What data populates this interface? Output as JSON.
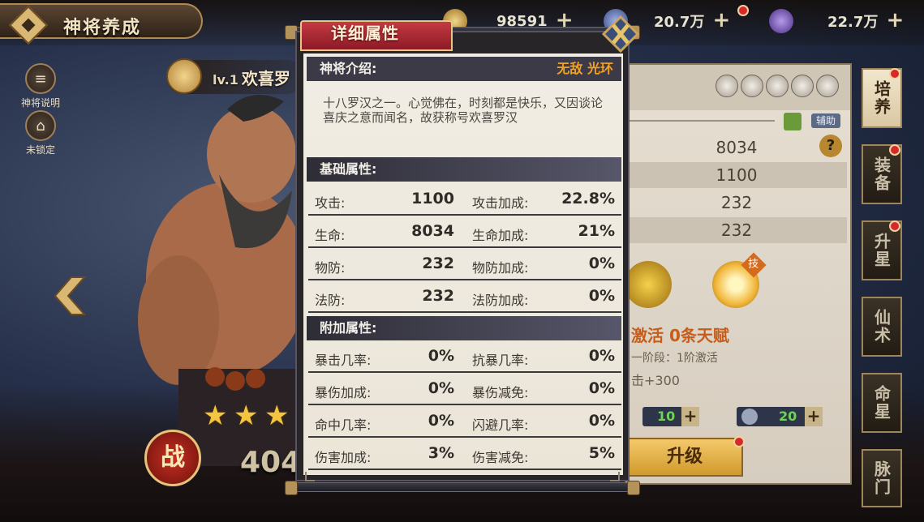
{
  "header": {
    "title": "神将养成",
    "resources": [
      {
        "name": "jade-resource",
        "value": "98591"
      },
      {
        "name": "gold-resource",
        "value": "20.7万"
      },
      {
        "name": "gem-resource",
        "value": "22.7万"
      }
    ]
  },
  "left_menu": [
    {
      "label": "神将说明"
    },
    {
      "label": "未锁定"
    }
  ],
  "hero": {
    "level": "lv.1",
    "name": "欢喜罗",
    "stars": 3,
    "battle_badge": "战",
    "power_visible": "404"
  },
  "modal": {
    "title": "详细属性",
    "intro_label": "神将介绍:",
    "intro_tag": "无敌 光环",
    "description": "十八罗汉之一。心觉佛在，时刻都是快乐，又因谈论喜庆之意而闻名，故获称号欢喜罗汉",
    "base_label": "基础属性:",
    "base_stats": [
      {
        "name1": "攻击:",
        "value1": "1100",
        "name2": "攻击加成:",
        "value2": "22.8%"
      },
      {
        "name1": "生命:",
        "value1": "8034",
        "name2": "生命加成:",
        "value2": "21%"
      },
      {
        "name1": "物防:",
        "value1": "232",
        "name2": "物防加成:",
        "value2": "0%"
      },
      {
        "name1": "法防:",
        "value1": "232",
        "name2": "法防加成:",
        "value2": "0%"
      }
    ],
    "extra_label": "附加属性:",
    "extra_stats": [
      {
        "name1": "暴击几率:",
        "value1": "0%",
        "name2": "抗暴几率:",
        "value2": "0%"
      },
      {
        "name1": "暴伤加成:",
        "value1": "0%",
        "name2": "暴伤减免:",
        "value2": "0%"
      },
      {
        "name1": "命中几率:",
        "value1": "0%",
        "name2": "闪避几率:",
        "value2": "0%"
      },
      {
        "name1": "伤害加成:",
        "value1": "3%",
        "name2": "伤害减免:",
        "value2": "5%"
      }
    ]
  },
  "right_panel": {
    "assist_label": "辅助",
    "stat_values": [
      "8034",
      "1100",
      "232",
      "232"
    ],
    "skill_badge": "技",
    "talent_text": "激活 0条天赋",
    "stage_text": "一阶段：1阶激活",
    "atk_text": "击+300",
    "counter1": "10",
    "counter2": "20",
    "upgrade_label": "升级"
  },
  "right_tabs": [
    {
      "label": "培养",
      "active": true
    },
    {
      "label": "装备",
      "active": false
    },
    {
      "label": "升星",
      "active": false
    },
    {
      "label": "仙术",
      "active": false
    },
    {
      "label": "命星",
      "active": false
    },
    {
      "label": "脉门",
      "active": false
    }
  ],
  "colors": {
    "modal_title_red": "#c53a43",
    "intro_tag_orange": "#f2a222",
    "counter_green": "#6fd35a",
    "upgrade_gold": "#f4c96a"
  }
}
